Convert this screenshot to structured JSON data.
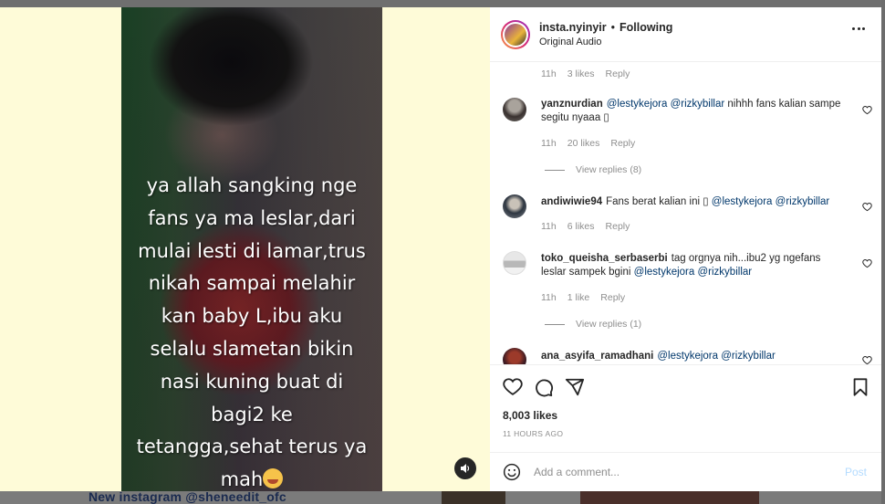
{
  "background": {
    "bottom_text": "New instagram @sheneedit_ofc"
  },
  "video": {
    "caption_lines": [
      "ya allah sangking nge",
      "fans ya ma leslar,dari",
      "mulai lesti di lamar,trus",
      "nikah sampai melahir",
      "kan baby L,ibu aku",
      "selalu slametan bikin",
      "nasi kuning buat di",
      "bagi2 ke",
      "tetangga,sehat terus ya",
      "mah"
    ],
    "audio_icon": "speaker-icon"
  },
  "header": {
    "username": "insta.nyinyir",
    "dot": "•",
    "follow_status": "Following",
    "audio": "Original Audio",
    "more_icon": "more-options-icon"
  },
  "comments": {
    "top_meta": {
      "time": "11h",
      "likes": "3 likes",
      "reply": "Reply"
    },
    "items": [
      {
        "user": "yanznurdian",
        "mention1": "@lestykejora",
        "mention2": "@rizkybillar",
        "text": "nihhh fans kalian sampe segitu nyaaa ",
        "tofu": "▯",
        "time": "11h",
        "likes": "20 likes",
        "reply": "Reply",
        "view_replies": "View replies (8)"
      },
      {
        "user": "andiwiwie94",
        "text_before": "Fans berat kalian ini ",
        "tofu": "▯",
        "mention1": "@lestykejora",
        "mention2": "@rizkybillar",
        "time": "11h",
        "likes": "6 likes",
        "reply": "Reply"
      },
      {
        "user": "toko_queisha_serbaserbi",
        "text": "tag orgnya nih...ibu2 yg ngefans leslar sampek bgini",
        "mention1": "@lestykejora",
        "mention2": "@rizkybillar",
        "time": "11h",
        "likes": "1 like",
        "reply": "Reply",
        "view_replies": "View replies (1)"
      },
      {
        "user": "ana_asyifa_ramadhani",
        "mention1": "@lestykejora",
        "mention2": "@rizkybillar"
      }
    ]
  },
  "actions": {
    "likes": "8,003 likes",
    "time_ago": "11 HOURS AGO"
  },
  "composer": {
    "placeholder": "Add a comment...",
    "post": "Post"
  },
  "colors": {
    "media_bg": "#fefbd8",
    "mention": "#00376b",
    "post_disabled": "#b3dbff"
  }
}
